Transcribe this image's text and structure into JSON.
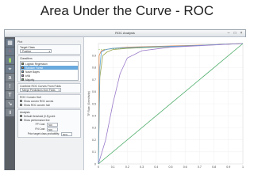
{
  "slide_title": "Area Under the Curve - ROC",
  "window": {
    "title": "ROC Analysis",
    "controls": [
      "–",
      "□",
      "×"
    ]
  },
  "toolbar": {
    "icons": [
      "table-icon",
      "scatter-icon",
      "bar-icon",
      "tree-icon",
      "text-a-icon",
      "exclamation-icon",
      "text-t-icon",
      "arrow-icon",
      "pause-icon"
    ]
  },
  "panel": {
    "plot_label": "Plot",
    "target_class_label": "Target Class",
    "target_class_value": "Positive",
    "classifiers_label": "Classifiers",
    "classifiers": [
      {
        "name": "Logistic Regression",
        "color": "#9aa64d",
        "selected": false
      },
      {
        "name": "Random Forest",
        "color": "#e18a4a",
        "selected": true
      },
      {
        "name": "Naive Bayes",
        "color": "#59a3d8",
        "selected": false
      },
      {
        "name": "kNN",
        "color": "#9a7bc9",
        "selected": false
      },
      {
        "name": "Majority",
        "color": "#4fae6b",
        "selected": false
      }
    ],
    "combine_label": "Combine ROC Curves From Folds",
    "combine_value": "Merge Predictions from Folds",
    "hull_label": "ROC Convex Hull",
    "hull_options": [
      {
        "label": "Show convex ROC curves",
        "checked": false
      },
      {
        "label": "Show ROC convex hull",
        "checked": false
      }
    ],
    "analysis_label": "Analysis",
    "analysis_options": [
      {
        "label": "Default threshold (0.5) point",
        "checked": true
      },
      {
        "label": "Show performance line",
        "checked": true
      }
    ],
    "fp_cost_label": "FP Cost:",
    "fp_cost_value": "500",
    "fn_cost_label": "FN Cost:",
    "fn_cost_value": "500",
    "prior_label": "Prior target class probability:",
    "prior_value": "50%"
  },
  "chart_data": {
    "type": "line",
    "title": "",
    "xlabel": "",
    "ylabel": "TP Rate (Sensitivity)",
    "xlim": [
      0,
      1
    ],
    "ylim": [
      0,
      1
    ],
    "x_ticks": [
      "0",
      "0.1",
      "0.2",
      "0.3",
      "0.4",
      "0.5",
      "0.6",
      "0.7",
      "0.8",
      "0.9",
      "1"
    ],
    "y_ticks": [
      "0",
      "0.1",
      "0.2",
      "0.3",
      "0.4",
      "0.5",
      "0.6",
      "0.7",
      "0.8",
      "0.9"
    ],
    "grid": true,
    "series": [
      {
        "name": "Logistic Regression",
        "color": "#9aa64d",
        "x": [
          0,
          0.01,
          0.03,
          0.06,
          0.1,
          0.2,
          0.4,
          0.6,
          0.8,
          1.0
        ],
        "y": [
          0,
          0.72,
          0.9,
          0.93,
          0.95,
          0.96,
          0.97,
          0.98,
          0.99,
          1.0
        ]
      },
      {
        "name": "Random Forest",
        "color": "#e18a4a",
        "x": [
          0,
          0.005,
          0.02,
          0.05,
          0.1,
          0.2,
          0.5,
          0.8,
          1.0
        ],
        "y": [
          0,
          0.9,
          0.94,
          0.95,
          0.96,
          0.97,
          0.98,
          0.99,
          1.0
        ]
      },
      {
        "name": "Naive Bayes",
        "color": "#59a3d8",
        "x": [
          0,
          0.01,
          0.02,
          0.05,
          0.1,
          0.3,
          0.6,
          1.0
        ],
        "y": [
          0,
          0.8,
          0.93,
          0.95,
          0.96,
          0.97,
          0.98,
          1.0
        ]
      },
      {
        "name": "kNN",
        "color": "#9a7bc9",
        "x": [
          0,
          0.05,
          0.1,
          0.15,
          0.2,
          0.3,
          0.5,
          1.0
        ],
        "y": [
          0,
          0.2,
          0.5,
          0.75,
          0.88,
          0.94,
          0.97,
          1.0
        ]
      },
      {
        "name": "Majority",
        "color": "#4fae6b",
        "x": [
          0,
          1.0
        ],
        "y": [
          0,
          1.0
        ]
      }
    ],
    "reference_line": {
      "x": [
        0,
        1
      ],
      "y": [
        0,
        1
      ],
      "color": "#c8c8c8"
    },
    "performance_line": {
      "x": [
        0,
        1
      ],
      "y": [
        0.95,
        1.0
      ],
      "color": "#8fbf4f"
    }
  }
}
